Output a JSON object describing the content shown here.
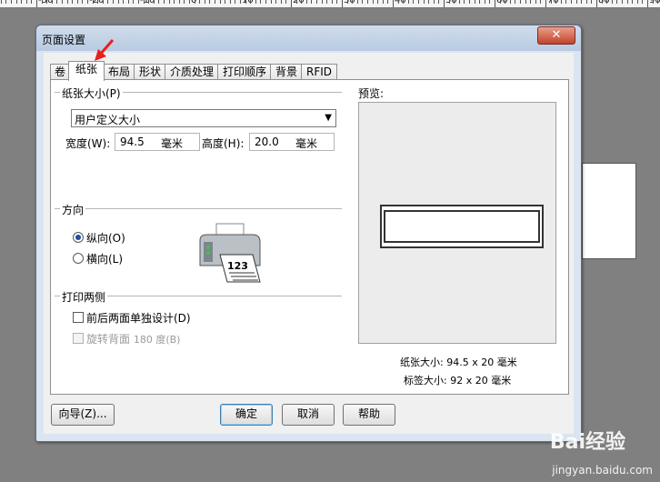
{
  "ruler": {
    "labels": [
      "-30",
      "-20",
      "-10",
      "0",
      "10",
      "20",
      "30",
      "40",
      "50",
      "60",
      "70",
      "80",
      "90"
    ]
  },
  "dialog": {
    "title": "页面设置",
    "close_icon": "close-icon",
    "tabs": [
      "卷",
      "纸张",
      "布局",
      "形状",
      "介质处理",
      "打印顺序",
      "背景",
      "RFID"
    ],
    "active_tab": "纸张",
    "paper_size": {
      "group_title": "纸张大小(P)",
      "selected": "用户定义大小",
      "width_label": "宽度(W):",
      "width_value": "94.5",
      "width_unit": "毫米",
      "height_label": "高度(H):",
      "height_value": "20.0",
      "height_unit": "毫米"
    },
    "orientation": {
      "group_title": "方向",
      "portrait": "纵向(O)",
      "landscape": "横向(L)",
      "selected": "portrait",
      "printer_badge": "123"
    },
    "duplex": {
      "group_title": "打印两侧",
      "separate_design": "前后两面单独设计(D)",
      "rotate_back_prefix": "旋转背面",
      "rotate_back_value": "180 度(B)"
    },
    "preview": {
      "title": "预览:",
      "paper_size_label": "纸张大小:",
      "paper_size_value": "94.5 x 20 毫米",
      "label_size_label": "标签大小:",
      "label_size_value": "92 x 20 毫米"
    },
    "buttons": {
      "wizard": "向导(Z)...",
      "ok": "确定",
      "cancel": "取消",
      "help": "帮助"
    }
  },
  "watermark": {
    "brand": "Bai经验",
    "url": "jingyan.baidu.com"
  },
  "colors": {
    "annotation_arrow": "#e8201a",
    "selected_radio": "#1f4e9c"
  }
}
